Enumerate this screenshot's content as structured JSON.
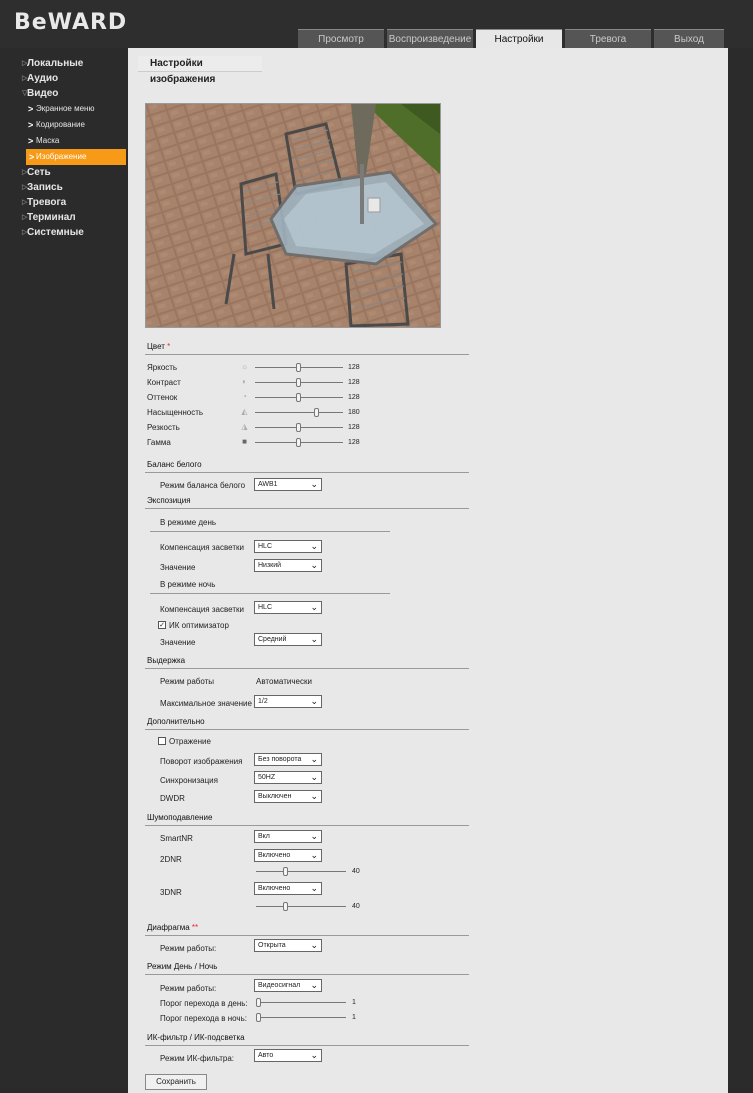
{
  "logo": "BeWARD",
  "tabs": [
    "Просмотр",
    "Воспроизведение",
    "Настройки",
    "Тревога",
    "Выход"
  ],
  "sidebar": {
    "items": [
      {
        "label": "Локальные"
      },
      {
        "label": "Аудио"
      },
      {
        "label": "Видео"
      },
      {
        "label": "Экранное меню"
      },
      {
        "label": "Кодирование"
      },
      {
        "label": "Маска"
      },
      {
        "label": "Изображение"
      },
      {
        "label": "Сеть"
      },
      {
        "label": "Запись"
      },
      {
        "label": "Тревога"
      },
      {
        "label": "Терминал"
      },
      {
        "label": "Системные"
      }
    ]
  },
  "page_title": "Настройки изображения",
  "color": {
    "section": "Цвет",
    "star": "*",
    "rows": [
      {
        "label": "Яркость",
        "value": "128",
        "level": 0.5
      },
      {
        "label": "Контраст",
        "value": "128",
        "level": 0.5
      },
      {
        "label": "Оттенок",
        "value": "128",
        "level": 0.5
      },
      {
        "label": "Насыщенность",
        "value": "180",
        "level": 0.71
      },
      {
        "label": "Резкость",
        "value": "128",
        "level": 0.5
      },
      {
        "label": "Гамма",
        "value": "128",
        "level": 0.5
      }
    ]
  },
  "white_balance": {
    "section": "Баланс белого",
    "mode_label": "Режим баланса белого",
    "mode_value": "AWB1"
  },
  "exposure": {
    "section": "Экспозиция",
    "day": {
      "title": "В режиме день",
      "comp_label": "Компенсация засветки",
      "comp_value": "HLC",
      "value_label": "Значение",
      "value": "Низкий"
    },
    "night": {
      "title": "В режиме ночь",
      "comp_label": "Компенсация засветки",
      "comp_value": "HLC",
      "ir_label": "ИК оптимизатор",
      "value_label": "Значение",
      "value": "Средний"
    }
  },
  "shutter": {
    "section": "Выдержка",
    "mode_label": "Режим работы",
    "mode_value": "Автоматически",
    "max_label": "Максимальное значение",
    "max_value": "1/2"
  },
  "extra": {
    "section": "Дополнительно",
    "mirror_label": "Отражение",
    "rotate_label": "Поворот изображения",
    "rotate_value": "Без поворота",
    "sync_label": "Синхронизация",
    "sync_value": "50HZ",
    "dwdr_label": "DWDR",
    "dwdr_value": "Выключен"
  },
  "noise": {
    "section": "Шумоподавление",
    "smartnr_label": "SmartNR",
    "smartnr_value": "Вкл",
    "dnr2_label": "2DNR",
    "dnr2_value": "Включено",
    "dnr2_level": "40",
    "dnr2_frac": 0.33,
    "dnr3_label": "3DNR",
    "dnr3_value": "Включено",
    "dnr3_level": "40",
    "dnr3_frac": 0.33
  },
  "iris": {
    "section": "Диафрагма",
    "stars": "**",
    "mode_label": "Режим работы:",
    "mode_value": "Открыта"
  },
  "daynight": {
    "section": "Режим День / Ночь",
    "mode_label": "Режим работы:",
    "mode_value": "Видеосигнал",
    "to_day_label": "Порог перехода в день:",
    "to_day_value": "1",
    "to_night_label": "Порог перехода в ночь:",
    "to_night_value": "1"
  },
  "ircut": {
    "section": "ИК-фильтр / ИК-подсветка",
    "mode_label": "Режим ИК-фильтра:",
    "mode_value": "Авто"
  },
  "save_label": "Сохранить",
  "colors": {
    "accent": "#f79a17",
    "background": "#e8e8e8",
    "chrome": "#2b2b2b"
  }
}
